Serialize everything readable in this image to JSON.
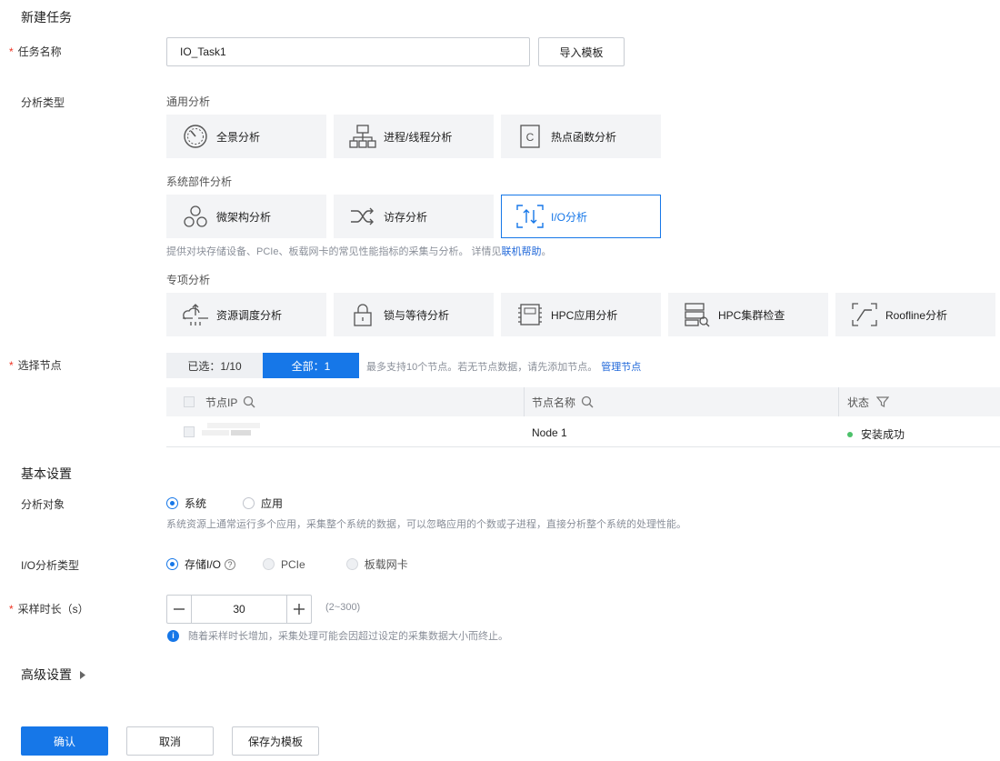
{
  "page": {
    "title": "新建任务"
  },
  "task_name": {
    "label": "任务名称",
    "value": "IO_Task1",
    "import_button": "导入模板"
  },
  "analysis_type": {
    "label": "分析类型",
    "general": {
      "title": "通用分析",
      "items": [
        "全景分析",
        "进程/线程分析",
        "热点函数分析"
      ]
    },
    "component": {
      "title": "系统部件分析",
      "items": [
        "微架构分析",
        "访存分析",
        "I/O分析"
      ],
      "selected": "I/O分析",
      "description": "提供对块存储设备、PCIe、板载网卡的常见性能指标的采集与分析。 详情见",
      "help_link": "联机帮助",
      "help_suffix": "。"
    },
    "special": {
      "title": "专项分析",
      "items": [
        "资源调度分析",
        "锁与等待分析",
        "HPC应用分析",
        "HPC集群检查",
        "Roofline分析"
      ]
    }
  },
  "nodes": {
    "label": "选择节点",
    "tab_selected": "已选：1/10",
    "tab_all": "全部：1",
    "hint": "最多支持10个节点。若无节点数据，请先添加节点。",
    "manage_link": "管理节点",
    "columns": [
      "节点IP",
      "节点名称",
      "状态"
    ],
    "rows": [
      {
        "ip": "",
        "name": "Node 1",
        "status": "安装成功",
        "status_color": "#4cc16a"
      }
    ]
  },
  "basic": {
    "title": "基本设置",
    "target": {
      "label": "分析对象",
      "options": [
        "系统",
        "应用"
      ],
      "selected": "系统",
      "description": "系统资源上通常运行多个应用，采集整个系统的数据，可以忽略应用的个数或子进程，直接分析整个系统的处理性能。"
    },
    "io_type": {
      "label": "I/O分析类型",
      "options": [
        "存储I/O",
        "PCIe",
        "板载网卡"
      ],
      "selected": "存储I/O"
    },
    "duration": {
      "label": "采样时长（s）",
      "value": "30",
      "range": "(2~300)",
      "info": "随着采样时长增加，采集处理可能会因超过设定的采集数据大小而终止。"
    }
  },
  "advanced": {
    "title": "高级设置"
  },
  "footer": {
    "confirm": "确认",
    "cancel": "取消",
    "save_template": "保存为模板"
  },
  "colors": {
    "accent": "#1677e8",
    "required": "#e32222",
    "card_bg": "#f3f4f6"
  }
}
